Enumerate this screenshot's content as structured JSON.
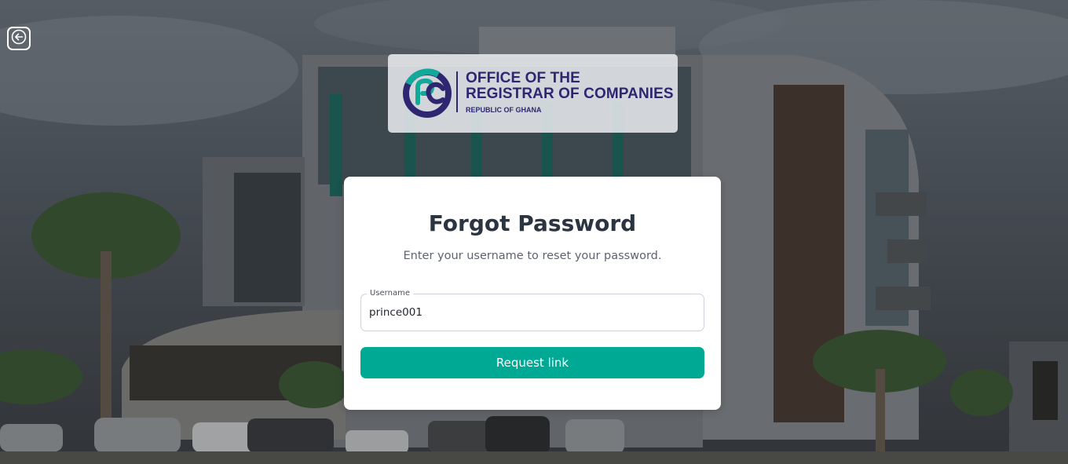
{
  "header": {
    "back_icon": "arrow-left-icon"
  },
  "logo": {
    "line1": "OFFICE OF THE",
    "line2": "REGISTRAR OF COMPANIES",
    "line3": "REPUBLIC OF GHANA",
    "colors": {
      "navy": "#2e2670",
      "teal": "#12a99b"
    }
  },
  "form": {
    "title": "Forgot Password",
    "subtitle": "Enter your username to reset your password.",
    "username_label": "Username",
    "username_value": "prince001",
    "submit_label": "Request link"
  },
  "colors": {
    "primary": "#00a993",
    "title_text": "#2b3441",
    "subtitle_text": "#5d6370"
  }
}
